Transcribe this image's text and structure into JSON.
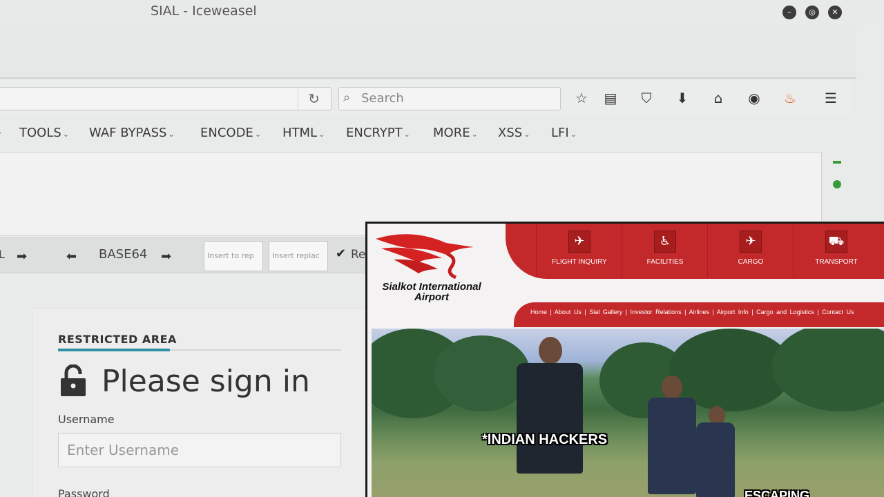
{
  "window": {
    "title": "SIAL - Iceweasel"
  },
  "navbar": {
    "search_placeholder": "Search"
  },
  "hackbar": {
    "menus": [
      "TOOLS",
      "WAF BYPASS",
      "ENCODE",
      "HTML",
      "ENCRYPT",
      "MORE",
      "XSS",
      "LFI"
    ]
  },
  "encoder": {
    "left_label": "L",
    "base64_label": "BASE64",
    "insert_to_placeholder": "Insert to rep",
    "insert_replace_placeholder": "Insert replac",
    "checkbox_label": "Re",
    "checkbox_checked": true
  },
  "login": {
    "section_label": "RESTRICTED AREA",
    "title": "Please sign in",
    "username_label": "Username",
    "username_placeholder": "Enter Username",
    "password_label": "Password"
  },
  "airport_site": {
    "logo_text": "Sialkot International Airport",
    "nav": [
      "FLIGHT INQUIRY",
      "FACILITIES",
      "CARGO",
      "TRANSPORT"
    ],
    "links": "Home | About Us | Sial Gallery | Investor Relations | Airlines | Airport Info | Cargo and Logistics | Contact Us",
    "caption_main": "*INDIAN HACKERS",
    "caption_secondary": "ESCAPING",
    "brand_color": "#c3292b"
  }
}
